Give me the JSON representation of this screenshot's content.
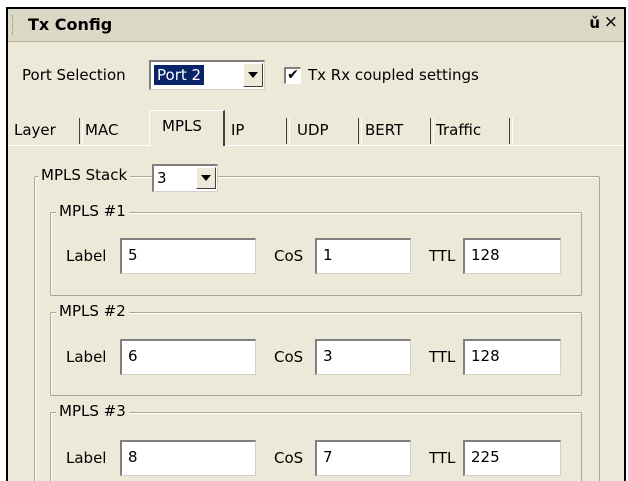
{
  "window": {
    "title": "Tx Config",
    "pin_glyph": "p",
    "close_glyph": "×"
  },
  "port": {
    "label": "Port Selection",
    "selected": "Port 2"
  },
  "coupled": {
    "checked": true,
    "check_mark": "✔",
    "label": "Tx Rx coupled settings"
  },
  "tabs": [
    {
      "label": "Layer"
    },
    {
      "label": "MAC"
    },
    {
      "label": "MPLS",
      "active": true
    },
    {
      "label": "IP"
    },
    {
      "label": "UDP"
    },
    {
      "label": "BERT"
    },
    {
      "label": "Traffic"
    }
  ],
  "stack": {
    "label": "MPLS Stack",
    "value": "3"
  },
  "mpls": [
    {
      "title": "MPLS #1",
      "label_caption": "Label",
      "label": "5",
      "cos_caption": "CoS",
      "cos": "1",
      "ttl_caption": "TTL",
      "ttl": "128"
    },
    {
      "title": "MPLS #2",
      "label_caption": "Label",
      "label": "6",
      "cos_caption": "CoS",
      "cos": "3",
      "ttl_caption": "TTL",
      "ttl": "128"
    },
    {
      "title": "MPLS #3",
      "label_caption": "Label",
      "label": "8",
      "cos_caption": "CoS",
      "cos": "7",
      "ttl_caption": "TTL",
      "ttl": "225"
    }
  ]
}
